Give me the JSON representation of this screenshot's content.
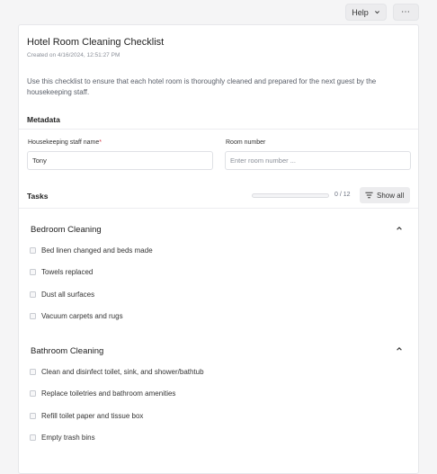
{
  "toolbar": {
    "help_label": "Help",
    "more_label": "⋯"
  },
  "checklist": {
    "title": "Hotel Room Cleaning Checklist",
    "created": "Created on 4/16/2024, 12:51:27 PM",
    "description": "Use this checklist to ensure that each hotel room is thoroughly cleaned and prepared for the next guest by the housekeeping staff."
  },
  "metadata": {
    "heading": "Metadata",
    "staff_label": "Housekeeping staff name",
    "staff_required_mark": "*",
    "staff_value": "Tony",
    "room_label": "Room number",
    "room_placeholder": "Enter room number ..."
  },
  "tasks": {
    "heading": "Tasks",
    "progress_done": 0,
    "progress_total": 12,
    "progress_text": "0 / 12",
    "show_all_label": "Show all",
    "groups": [
      {
        "title": "Bedroom Cleaning",
        "items": [
          "Bed linen changed and beds made",
          "Towels replaced",
          "Dust all surfaces",
          "Vacuum carpets and rugs"
        ]
      },
      {
        "title": "Bathroom Cleaning",
        "items": [
          "Clean and disinfect toilet, sink, and shower/bathtub",
          "Replace toiletries and bathroom amenities",
          "Refill toilet paper and tissue box",
          "Empty trash bins"
        ]
      }
    ]
  }
}
